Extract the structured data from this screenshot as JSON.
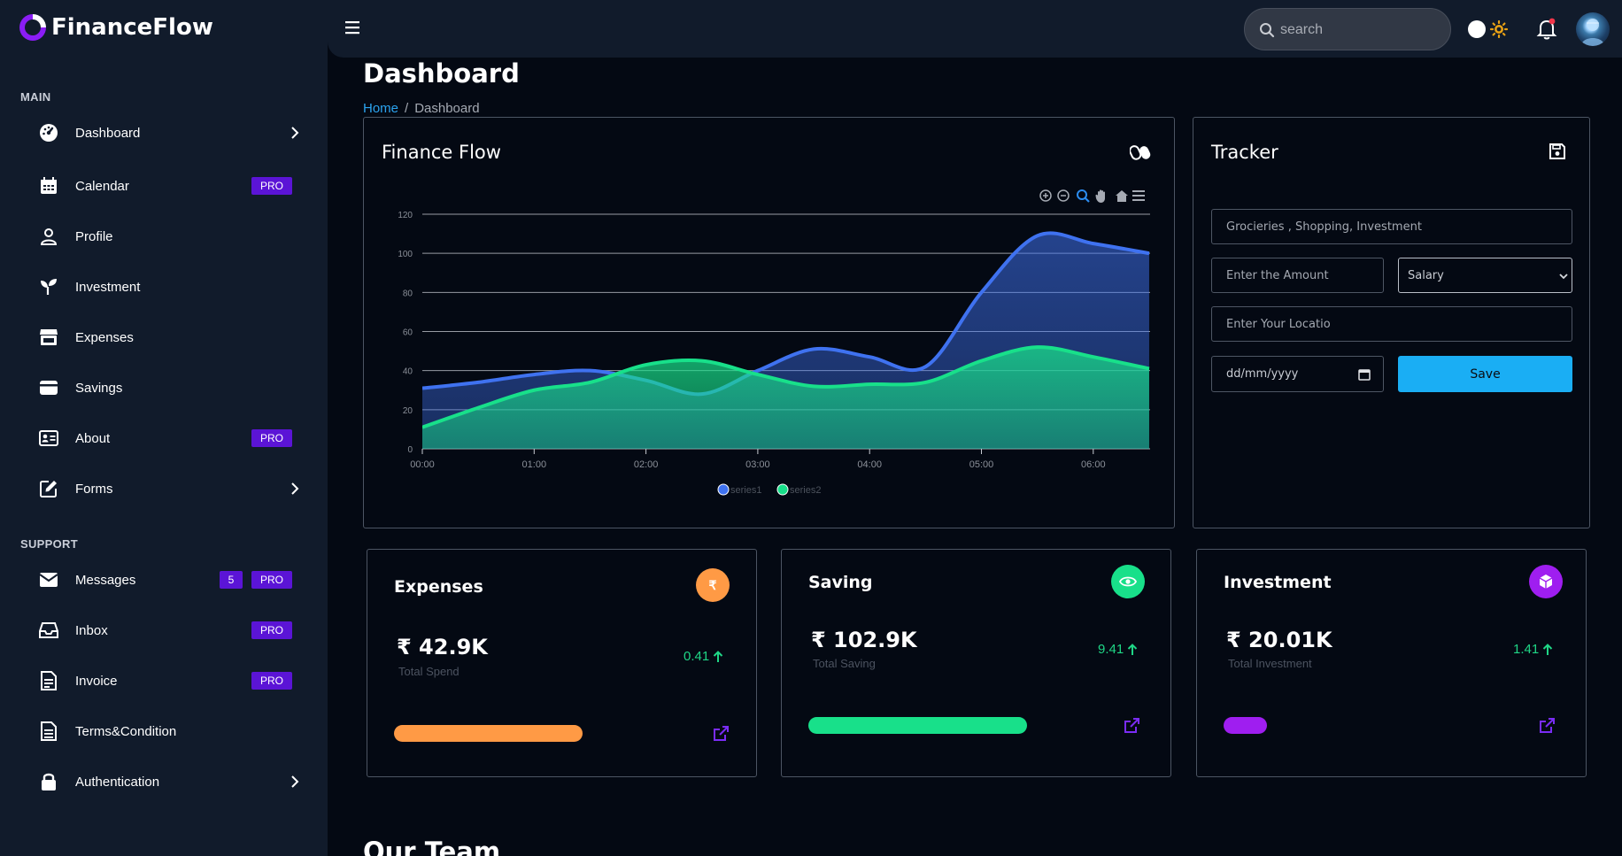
{
  "brand": {
    "name": "FinanceFlow"
  },
  "sidebar": {
    "sections": [
      "MAIN",
      "SUPPORT"
    ],
    "items": [
      {
        "label": "Dashboard",
        "icon": "speedometer-icon",
        "chevron": true
      },
      {
        "label": "Calendar",
        "icon": "calendar-icon",
        "pro": "PRO"
      },
      {
        "label": "Profile",
        "icon": "user-icon"
      },
      {
        "label": "Investment",
        "icon": "sprout-icon"
      },
      {
        "label": "Expenses",
        "icon": "shop-icon"
      },
      {
        "label": "Savings",
        "icon": "wallet-icon"
      },
      {
        "label": "About",
        "icon": "id-card-icon",
        "pro": "PRO"
      },
      {
        "label": "Forms",
        "icon": "edit-icon",
        "chevron": true
      },
      {
        "label": "Messages",
        "icon": "envelope-icon",
        "count": "5",
        "pro": "PRO"
      },
      {
        "label": "Inbox",
        "icon": "inbox-icon",
        "pro": "PRO"
      },
      {
        "label": "Invoice",
        "icon": "invoice-icon",
        "pro": "PRO"
      },
      {
        "label": "Terms&Condition",
        "icon": "document-icon"
      },
      {
        "label": "Authentication",
        "icon": "lock-icon",
        "chevron": true
      }
    ]
  },
  "topbar": {
    "search_placeholder": "search"
  },
  "page": {
    "title": "Dashboard",
    "breadcrumb": {
      "home": "Home",
      "separator": "/",
      "current": "Dashboard"
    },
    "section_heading": "Our Team"
  },
  "chart_card": {
    "title": "Finance Flow"
  },
  "chart_data": {
    "type": "area",
    "x": [
      "00:00",
      "00:30",
      "01:00",
      "01:30",
      "02:00",
      "02:30",
      "03:00",
      "03:30",
      "04:00",
      "04:30",
      "05:00",
      "05:30",
      "06:00",
      "06:30"
    ],
    "categories": [
      "00:00",
      "01:00",
      "02:00",
      "03:00",
      "04:00",
      "05:00",
      "06:00"
    ],
    "series": [
      {
        "name": "series1",
        "color": "#3f72f0",
        "values": [
          31,
          34,
          38,
          40,
          35,
          28,
          40,
          51,
          47,
          42,
          80,
          109,
          105,
          100
        ]
      },
      {
        "name": "series2",
        "color": "#18e08a",
        "values": [
          11,
          21,
          30,
          34,
          43,
          45,
          38,
          32,
          33,
          34,
          45,
          52,
          47,
          41
        ]
      }
    ],
    "ylim": [
      0,
      120
    ],
    "yticks": [
      0,
      20,
      40,
      60,
      80,
      100,
      120
    ],
    "grid": true,
    "legend_position": "bottom"
  },
  "tracker": {
    "title": "Tracker",
    "category_placeholder": "Grocieries , Shopping, Investment",
    "amount_placeholder": "Enter the Amount",
    "type_selected": "Salary",
    "location_placeholder": "Enter Your Locatio",
    "date_placeholder": "dd/mm/yyyy",
    "save_label": "Save"
  },
  "stats": [
    {
      "title": "Expenses",
      "value": "₹ 42.9K",
      "sub": "Total Spend",
      "change": "0.41",
      "color": "#ff9a45",
      "progress": 0.56,
      "icon": "rupee-icon"
    },
    {
      "title": "Saving",
      "value": "₹ 102.9K",
      "sub": "Total Saving",
      "change": "9.41",
      "color": "#18e08a",
      "progress": 0.65,
      "icon": "eye-icon"
    },
    {
      "title": "Investment",
      "value": "₹ 20.01K",
      "sub": "Total Investment",
      "change": "1.41",
      "color": "#9f1ef0",
      "progress": 0.13,
      "icon": "cube-icon"
    }
  ],
  "colors": {
    "accent": "#5b14d6",
    "link": "#2ba3ef",
    "save": "#1aaef4",
    "positive": "#1fd686"
  }
}
